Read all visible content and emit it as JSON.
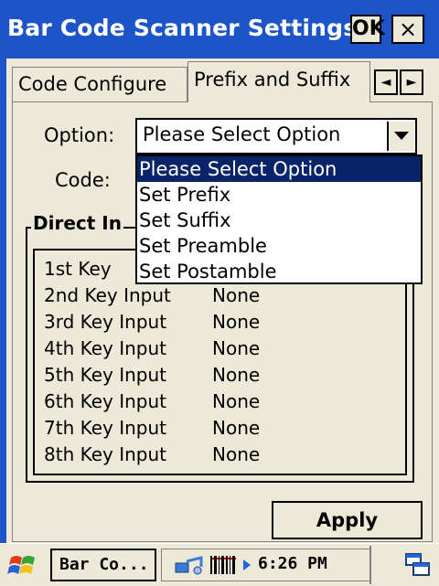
{
  "window": {
    "title": "Bar Code Scanner Settings",
    "ok_label": "OK",
    "close_label": "×"
  },
  "tabs": [
    {
      "label": "Code Configure",
      "active": false
    },
    {
      "label": "Prefix and Suffix",
      "active": true
    }
  ],
  "tab_scroll": {
    "left": "◄",
    "right": "►"
  },
  "form": {
    "option_label": "Option:",
    "option_value": "Please Select Option",
    "code_label": "Code:"
  },
  "dropdown": {
    "options": [
      "Please Select Option",
      "Set Prefix",
      "Set Suffix",
      "Set Preamble",
      "Set Postamble"
    ],
    "selected_index": 0
  },
  "direct_input": {
    "title": "Direct In",
    "rows": [
      {
        "label": "1st  Key",
        "value": ""
      },
      {
        "label": "2nd Key Input",
        "value": "None"
      },
      {
        "label": "3rd Key Input",
        "value": "None"
      },
      {
        "label": "4th Key Input",
        "value": "None"
      },
      {
        "label": "5th Key Input",
        "value": "None"
      },
      {
        "label": "6th Key Input",
        "value": "None"
      },
      {
        "label": "7th Key Input",
        "value": "None"
      },
      {
        "label": "8th Key Input",
        "value": "None"
      }
    ]
  },
  "apply_label": "Apply",
  "taskbar": {
    "task_label": "Bar Co...",
    "clock": "6:26 PM",
    "icons": [
      "start-flag-icon",
      "network-icon",
      "barcode-icon",
      "tray-arrow-icon",
      "desktop-icon"
    ]
  },
  "colors": {
    "title_bar": "#1d55c9",
    "selection": "#0a246a",
    "background": "#ece9d8"
  }
}
